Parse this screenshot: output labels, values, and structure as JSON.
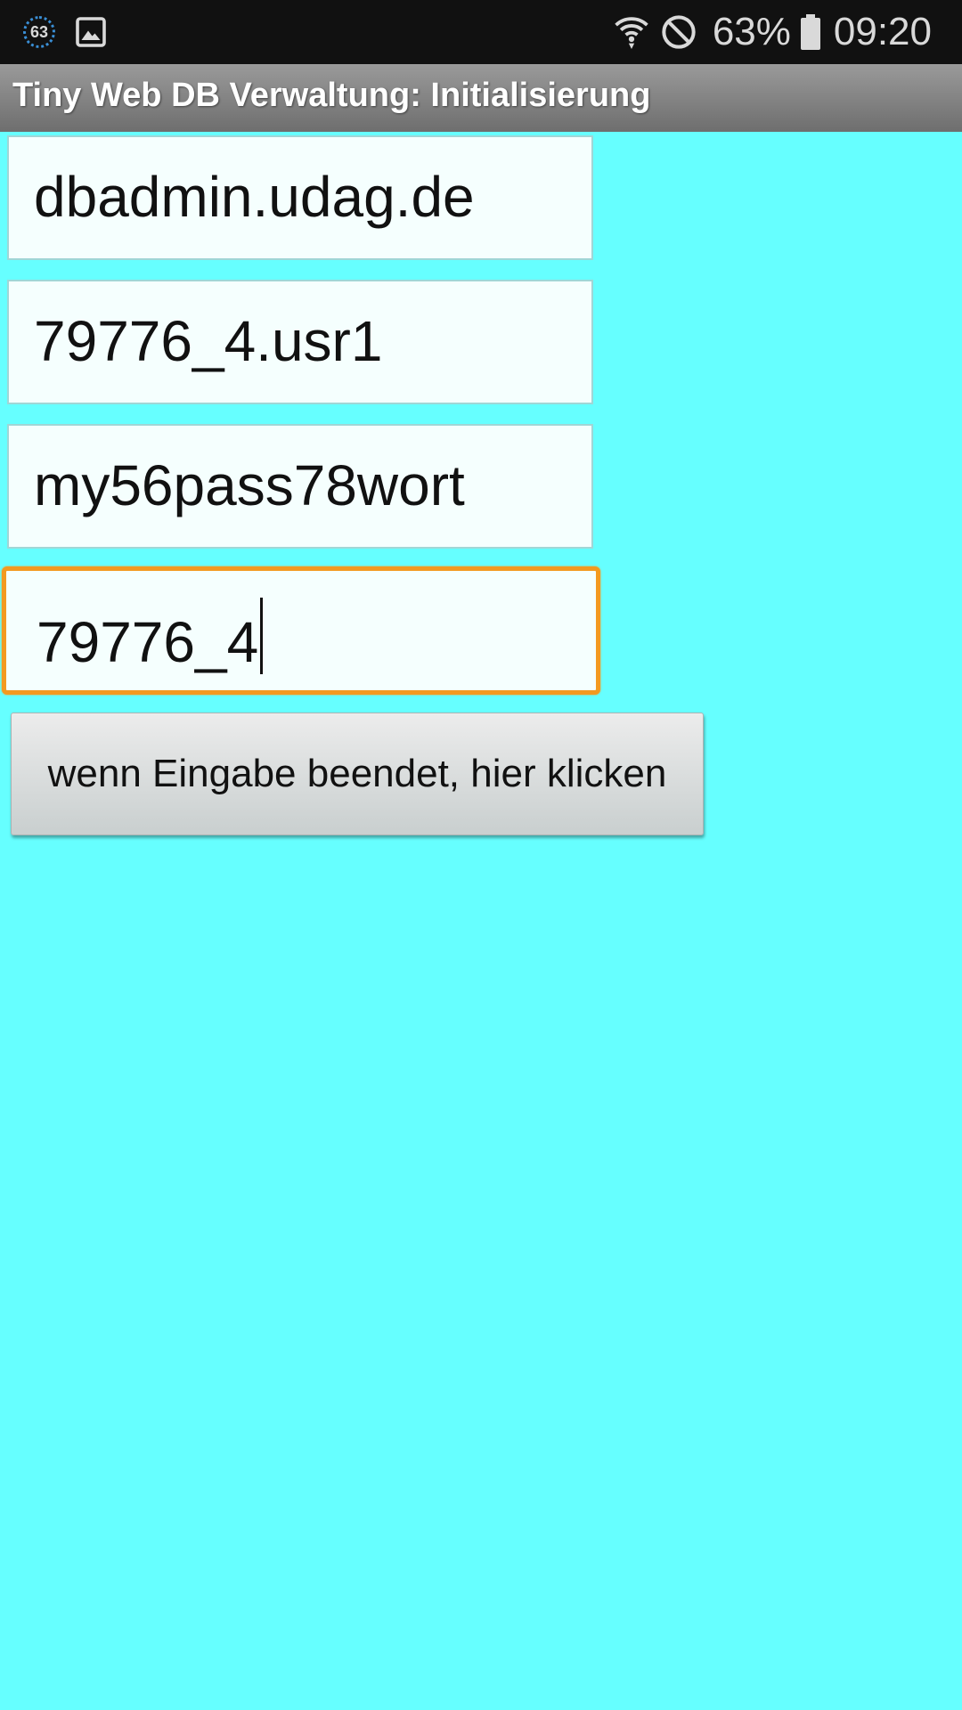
{
  "status_bar": {
    "notification_badge": "63",
    "battery_percent": "63%",
    "time": "09:20",
    "icons": [
      "notification-count-icon",
      "gallery-icon",
      "wifi-icon",
      "do-not-disturb-icon",
      "battery-icon"
    ]
  },
  "app": {
    "title": "Tiny Web DB Verwaltung: Initialisierung"
  },
  "form": {
    "fields": [
      {
        "value": "dbadmin.udag.de"
      },
      {
        "value": "79776_4.usr1"
      },
      {
        "value": "my56pass78wort"
      },
      {
        "value": "79776_4",
        "focused": true
      }
    ],
    "submit_label": "wenn Eingabe beendet, hier klicken"
  },
  "colors": {
    "background": "#66ffff",
    "focus_border": "#f39a20",
    "title_bar": "#8a8a8a"
  }
}
